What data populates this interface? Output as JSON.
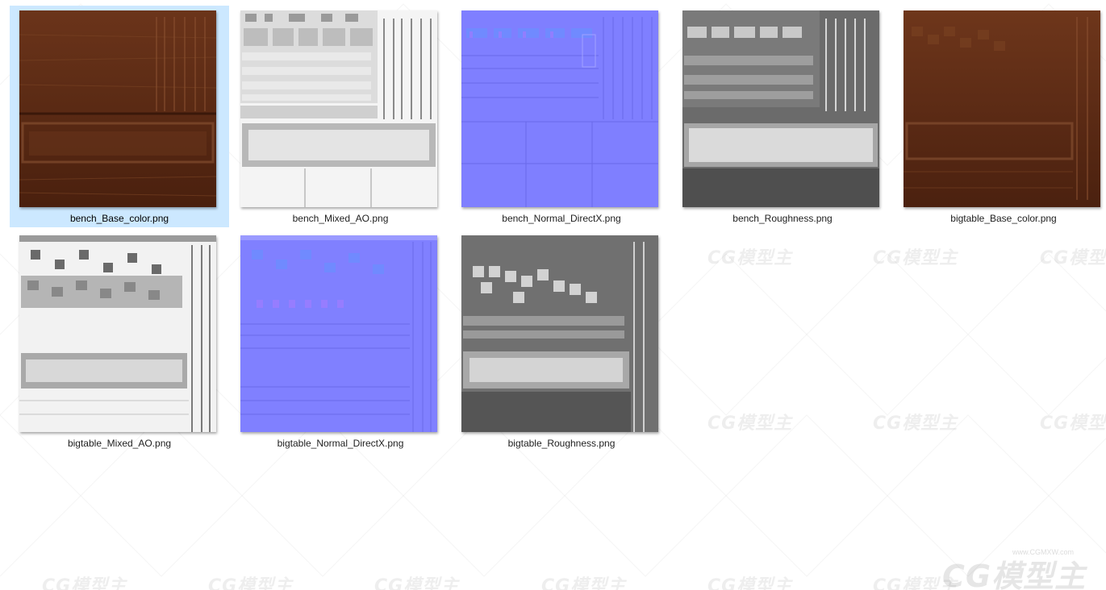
{
  "folder": {
    "files": [
      {
        "name": "bench_Base_color.png",
        "type": "base",
        "selected": true
      },
      {
        "name": "bench_Mixed_AO.png",
        "type": "ao",
        "selected": false
      },
      {
        "name": "bench_Normal_DirectX.png",
        "type": "normal",
        "selected": false
      },
      {
        "name": "bench_Roughness.png",
        "type": "rough",
        "selected": false
      },
      {
        "name": "bigtable_Base_color.png",
        "type": "base",
        "selected": false
      },
      {
        "name": "bigtable_Mixed_AO.png",
        "type": "ao",
        "selected": false
      },
      {
        "name": "bigtable_Normal_DirectX.png",
        "type": "normal",
        "selected": false
      },
      {
        "name": "bigtable_Roughness.png",
        "type": "rough",
        "selected": false
      }
    ]
  },
  "watermark": {
    "logo_text": "CG模型主",
    "site_text": "www.CGMXW.com"
  },
  "colors": {
    "selection": "#cce8ff",
    "wood": "#5a2a14",
    "normal": "#7f7fff"
  }
}
